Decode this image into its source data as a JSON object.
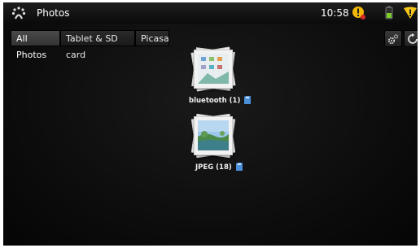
{
  "status_bar": {
    "app_title": "Photos",
    "time": "10:58",
    "icons": [
      "photos-app-icon",
      "alert-icon",
      "battery-icon",
      "warning-icon"
    ]
  },
  "tabs": [
    {
      "label": "All Photos",
      "active": true
    },
    {
      "label": "Tablet & SD card",
      "active": false
    },
    {
      "label": "Picasa",
      "active": false
    }
  ],
  "toolbar_icons": [
    "settings-icon",
    "refresh-icon"
  ],
  "albums": [
    {
      "name": "bluetooth",
      "count": "(1)",
      "source_icon": "sd-card-icon"
    },
    {
      "name": "JPEG",
      "count": "(18)",
      "source_icon": "sd-card-icon"
    }
  ],
  "colors": {
    "background": "#0b0b0b",
    "accent": "#f5c518"
  }
}
